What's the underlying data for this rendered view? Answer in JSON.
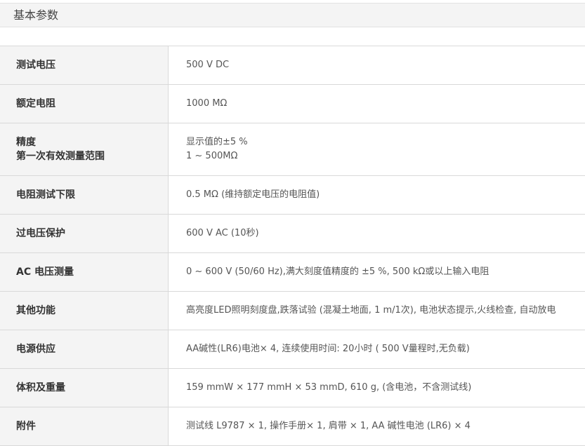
{
  "section": {
    "title": "基本参数"
  },
  "specs": [
    {
      "label": "测试电压",
      "value": "500 V DC"
    },
    {
      "label": "额定电阻",
      "value": "1000 MΩ"
    },
    {
      "label": "精度",
      "label2": "第一次有效测量范围",
      "value": "显示值的±5 %",
      "value2": "1 ~ 500MΩ"
    },
    {
      "label": "电阻测试下限",
      "value": "0.5 MΩ (维持额定电压的电阻值)"
    },
    {
      "label": "过电压保护",
      "value": "600 V AC (10秒)"
    },
    {
      "label": "AC 电压测量",
      "value": "0 ~ 600 V (50/60 Hz),满大刻度值精度的 ±5 %, 500 kΩ或以上输入电阻"
    },
    {
      "label": "其他功能",
      "value": "高亮度LED照明刻度盘,跌落试验 (混凝土地面, 1 m/1次), 电池状态提示,火线检查, 自动放电"
    },
    {
      "label": "电源供应",
      "value": "AA碱性(LR6)电池× 4, 连续使用时间: 20小时 ( 500 V量程时,无负载)"
    },
    {
      "label": "体积及重量",
      "value": "159 mmW × 177 mmH × 53 mmD, 610 g, (含电池，不含测试线)"
    },
    {
      "label": "附件",
      "value": "测试线 L9787 × 1, 操作手册× 1, 肩带 × 1, AA 碱性电池 (LR6) × 4"
    }
  ]
}
